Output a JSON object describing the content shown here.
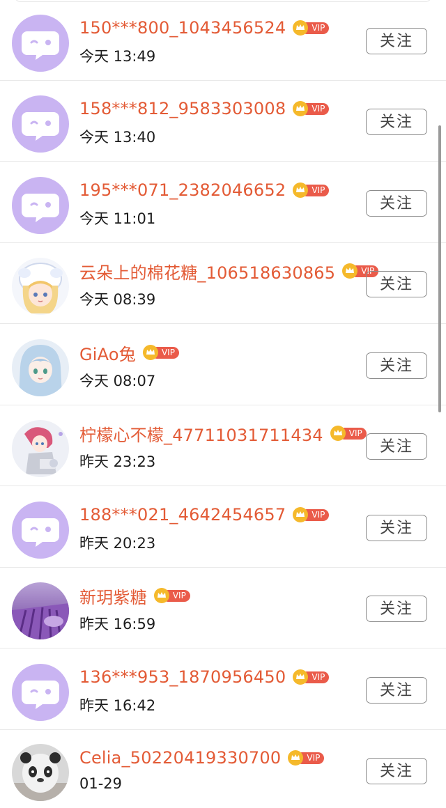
{
  "follow_label": "关注",
  "vip_label": "VIP",
  "colors": {
    "name": "#e35b36",
    "vip_badge": "#ea5b4a",
    "vip_crown": "#f5b92b",
    "default_avatar": "#c9b4f2"
  },
  "users": [
    {
      "name": "150***800_1043456524",
      "time": "今天 13:49",
      "avatar": "default-chat-bubble-avatar"
    },
    {
      "name": "158***812_9583303008",
      "time": "今天 13:40",
      "avatar": "default-chat-bubble-avatar"
    },
    {
      "name": "195***071_2382046652",
      "time": "今天 11:01",
      "avatar": "default-chat-bubble-avatar"
    },
    {
      "name": "云朵上的棉花糖_106518630865",
      "time": "今天 08:39",
      "avatar": "anime-girl-white-hat-avatar"
    },
    {
      "name": "GiAo兔",
      "time": "今天 08:07",
      "avatar": "anime-girl-blue-hair-avatar"
    },
    {
      "name": "柠檬心不檬_47711031711434",
      "time": "昨天 23:23",
      "avatar": "anime-girl-pink-hair-avatar"
    },
    {
      "name": "188***021_4642454657",
      "time": "昨天 20:23",
      "avatar": "default-chat-bubble-avatar"
    },
    {
      "name": "新玥紫糖",
      "time": "昨天 16:59",
      "avatar": "lavender-field-avatar"
    },
    {
      "name": "136***953_1870956450",
      "time": "昨天 16:42",
      "avatar": "default-chat-bubble-avatar"
    },
    {
      "name": "Celia_50220419330700",
      "time": "01-29",
      "avatar": "panda-hat-photo-avatar"
    }
  ]
}
